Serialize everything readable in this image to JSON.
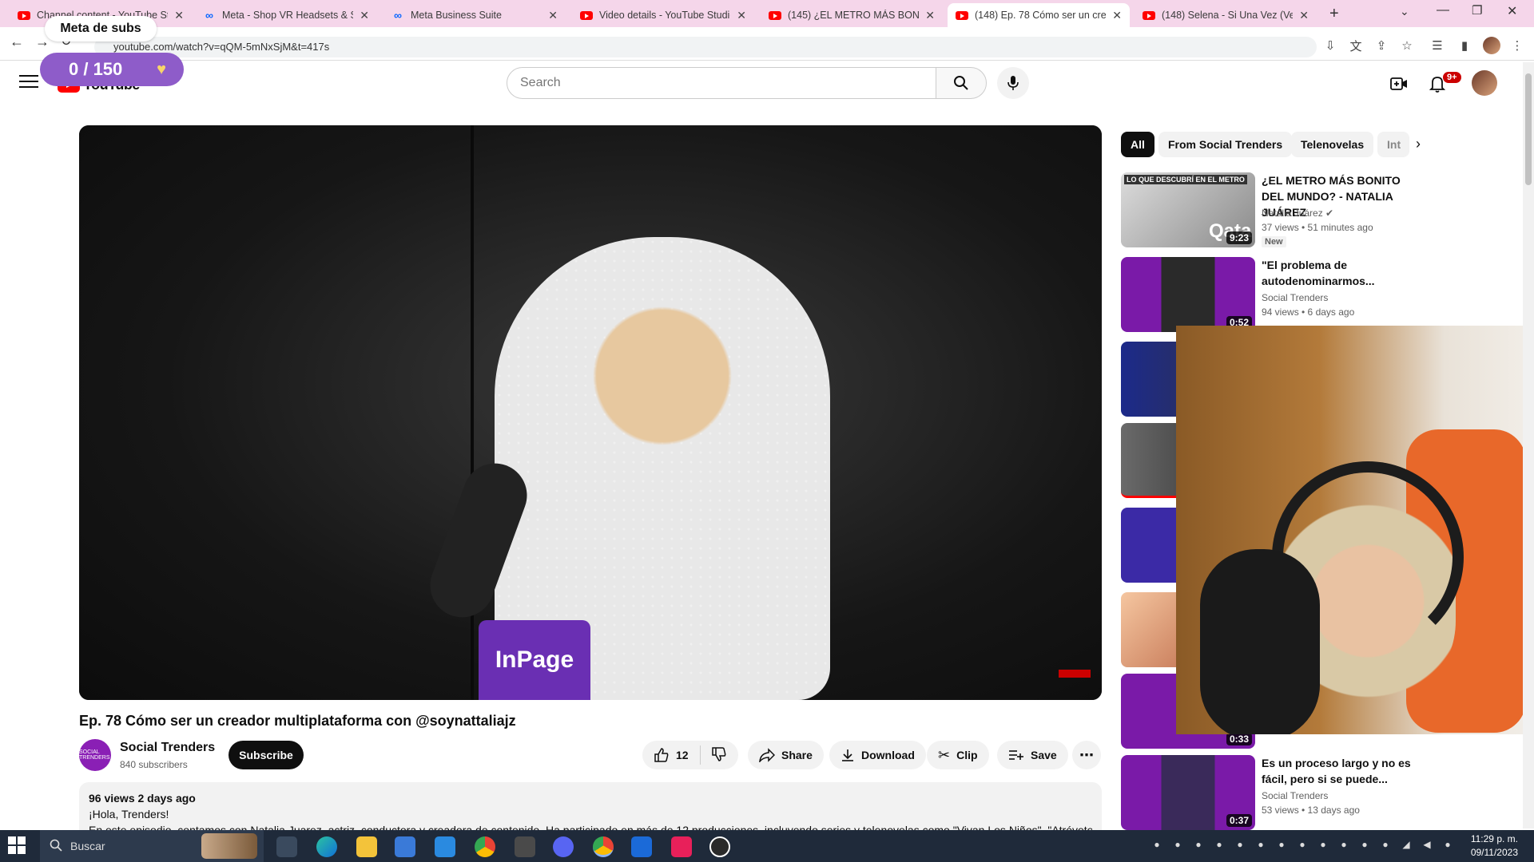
{
  "browser": {
    "tabs": [
      {
        "title": "Channel content - YouTube Stu",
        "icon": "youtube-icon"
      },
      {
        "title": "Meta - Shop VR Headsets & Sm",
        "icon": "meta-icon"
      },
      {
        "title": "Meta Business Suite",
        "icon": "meta-icon"
      },
      {
        "title": "Video details - YouTube Studio",
        "icon": "youtube-icon"
      },
      {
        "title": "(145) ¿EL METRO MÁS BONITO",
        "icon": "youtube-icon"
      },
      {
        "title": "(148) Ep. 78 Cómo ser un crea",
        "icon": "youtube-icon"
      },
      {
        "title": "(148) Selena - Si Una Vez (Vers",
        "icon": "youtube-icon"
      }
    ],
    "new_tab": "+",
    "url": "youtube.com/watch?v=qQM-5mNxSjM&t=417s"
  },
  "overlay": {
    "goal_title": "Meta de subs",
    "goal_count": "0 / 150",
    "heart": "♥"
  },
  "youtube": {
    "logo_text": "YouTube",
    "search_placeholder": "Search",
    "notification_count": "9+",
    "colors": {
      "brand": "#ff0000",
      "subscribe_bg": "#0f0f0f"
    }
  },
  "video": {
    "title": "Ep. 78 Cómo ser un creador multiplataforma con @soynattaliajz",
    "mug_text": "InPage",
    "channel": {
      "name": "Social Trenders",
      "subs": "840 subscribers",
      "avatar_text": "SOCIAL TRENDERS"
    },
    "subscribe_label": "Subscribe",
    "actions": {
      "likes": "12",
      "share": "Share",
      "download": "Download",
      "clip": "Clip",
      "save": "Save"
    },
    "description": {
      "meta": "96 views  2 days ago",
      "line1": "¡Hola, Trenders!",
      "line2": "En este episodio, contamos con Natalia Juarez, actriz, conductora y creadora de contenido. Ha participado en más de 12 producciones, incluyendo series y telenovelas como \"Vivan Los Niños\", \"Atrévete"
    }
  },
  "chips": [
    "All",
    "From Social Trenders",
    "Telenovelas",
    "Int"
  ],
  "recommendations": [
    {
      "title": "¿EL METRO MÁS BONITO DEL MUNDO? - NATALIA JUÁREZ",
      "channel": "Natalia Juárez ✔",
      "meta": "37 views  •  51 minutes ago",
      "duration": "9:23",
      "new": "New",
      "thumb_text": "LO QUE DESCUBRÍ EN EL METRO",
      "thumb_overlay": "Qata"
    },
    {
      "title": "\"El problema de autodenominarmos...",
      "channel": "Social Trenders",
      "meta": "94 views  •  6 days ago",
      "duration": "0:52"
    },
    {
      "title": "",
      "channel": "",
      "meta": "",
      "duration": ""
    },
    {
      "title": "",
      "channel": "",
      "meta": "",
      "duration": ""
    },
    {
      "title": "",
      "channel": "",
      "meta": "",
      "duration": ""
    },
    {
      "title": "",
      "channel": "",
      "meta": "",
      "duration": ""
    },
    {
      "title": "",
      "channel": "",
      "meta": "",
      "duration": "0:33"
    },
    {
      "title": "Es un proceso largo y no es fácil, pero si se puede...",
      "channel": "Social Trenders",
      "meta": "53 views  •  13 days ago",
      "duration": "0:37"
    }
  ],
  "taskbar": {
    "search_label": "Buscar",
    "time": "11:29 p. m.",
    "date": "09/11/2023"
  }
}
